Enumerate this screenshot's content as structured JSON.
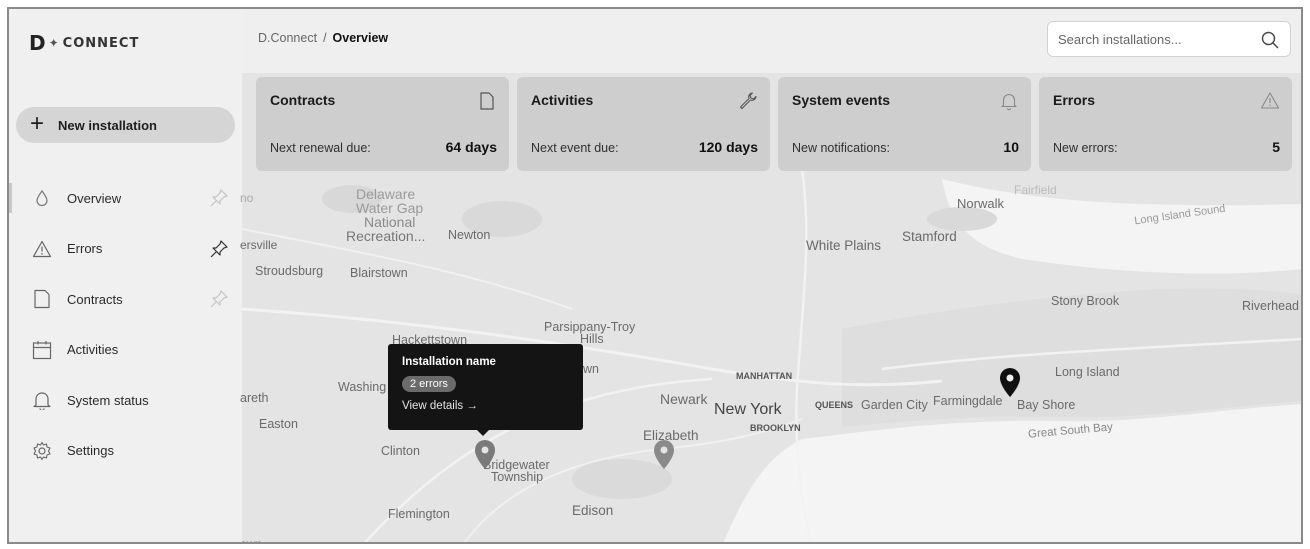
{
  "app": {
    "logo_d": "D",
    "logo_spark": "✦",
    "logo_word": "CONNECT"
  },
  "sidebar": {
    "new_button_label": "New installation",
    "items": [
      {
        "label": "Overview",
        "icon": "drop-icon",
        "pinned": true
      },
      {
        "label": "Errors",
        "icon": "warning-icon",
        "pinned": true
      },
      {
        "label": "Contracts",
        "icon": "document-icon",
        "pinned": true
      },
      {
        "label": "Activities",
        "icon": "calendar-icon",
        "pinned": false
      },
      {
        "label": "System status",
        "icon": "bell-icon",
        "pinned": false
      },
      {
        "label": "Settings",
        "icon": "gear-icon",
        "pinned": false
      }
    ]
  },
  "header": {
    "breadcrumb_root": "D.Connect",
    "breadcrumb_sep": "/",
    "breadcrumb_current": "Overview",
    "search_placeholder": "Search installations..."
  },
  "cards": [
    {
      "title": "Contracts",
      "label": "Next renewal due:",
      "value": "64 days",
      "icon": "document-icon"
    },
    {
      "title": "Activities",
      "label": "Next event due:",
      "value": "120 days",
      "icon": "wrench-icon"
    },
    {
      "title": "System events",
      "label": "New notifications:",
      "value": "10",
      "icon": "bell-icon"
    },
    {
      "title": "Errors",
      "label": "New errors:",
      "value": "5",
      "icon": "warning-icon"
    }
  ],
  "map": {
    "labels": {
      "delaware": "Delaware",
      "water_gap": "Water Gap",
      "national": "National",
      "recreation": "Recreation...",
      "newton": "Newton",
      "ersville": "ersville",
      "stroudsburg": "Stroudsburg",
      "blairstown": "Blairstown",
      "hackettstown": "Hackettstown",
      "parsippany": "Parsippany-Troy",
      "hills": "Hills",
      "wn": "wn",
      "washing": "Washing",
      "areth": "areth",
      "easton": "Easton",
      "clinton": "Clinton",
      "bridgewater": "Bridgewater",
      "township": "Township",
      "flemington": "Flemington",
      "edison": "Edison",
      "elizabeth": "Elizabeth",
      "newark": "Newark",
      "manhattan": "MANHATTAN",
      "new_york": "New York",
      "brooklyn": "BROOKLYN",
      "queens": "QUEENS",
      "garden_city": "Garden City",
      "farmingdale": "Farmingdale",
      "bay_shore": "Bay Shore",
      "great_south_bay": "Great South Bay",
      "long_island": "Long Island",
      "stony_brook": "Stony Brook",
      "riverhead": "Riverhead",
      "white_plains": "White Plains",
      "stamford": "Stamford",
      "norwalk": "Norwalk",
      "fairfield": "Fairfield",
      "long_island_sound": "Long Island Sound",
      "no": "no",
      "own": "own"
    },
    "tooltip": {
      "name": "Installation name",
      "badge": "2 errors",
      "link": "View details →"
    }
  },
  "colors": {
    "sidebar_bg": "#f0f0f0",
    "card_bg": "#cecece",
    "tooltip_bg": "#141414",
    "marker_dark": "#111111",
    "marker_grey": "#7a7a7a"
  }
}
